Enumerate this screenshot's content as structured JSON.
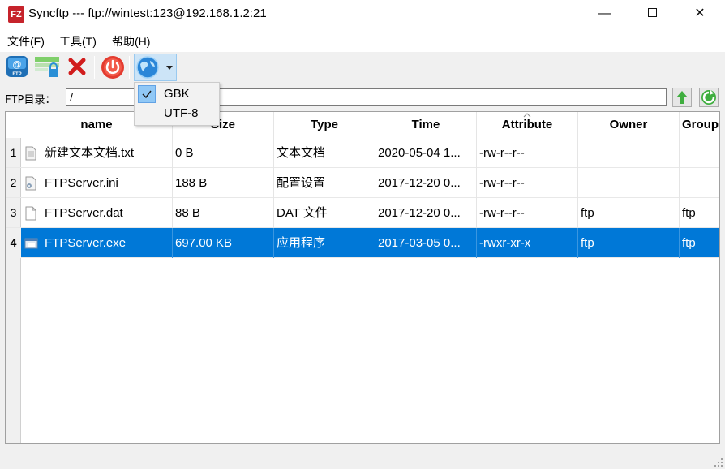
{
  "window": {
    "title": "Syncftp --- ftp://wintest:123@192.168.1.2:21",
    "app_icon_letters": "FZ",
    "minimize_glyph": "—",
    "close_glyph": "✕"
  },
  "menu": {
    "items": [
      {
        "label": "文件(F)"
      },
      {
        "label": "工具(T)"
      },
      {
        "label": "帮助(H)"
      }
    ]
  },
  "toolbar": {
    "buttons": [
      {
        "icon": "ftp-connect-icon"
      },
      {
        "icon": "lock-connection-icon"
      },
      {
        "icon": "disconnect-x-icon"
      },
      {
        "icon": "power-icon"
      },
      {
        "icon": "globe-encoding-icon"
      }
    ]
  },
  "encoding_menu": {
    "items": [
      {
        "label": "GBK",
        "checked": true
      },
      {
        "label": "UTF-8",
        "checked": false
      }
    ]
  },
  "path": {
    "label": "FTP目录：",
    "value": "/"
  },
  "table": {
    "columns": [
      "name",
      "Size",
      "Type",
      "Time",
      "Attribute",
      "Owner",
      "Group"
    ],
    "rows": [
      {
        "num": "1",
        "name": "新建文本文档.txt",
        "size": "0 B",
        "type": "文本文档",
        "time": "2020-05-04 1...",
        "attribute": "-rw-r--r--",
        "owner": "",
        "group": ""
      },
      {
        "num": "2",
        "name": "FTPServer.ini",
        "size": "188 B",
        "type": "配置设置",
        "time": "2017-12-20 0...",
        "attribute": "-rw-r--r--",
        "owner": "",
        "group": ""
      },
      {
        "num": "3",
        "name": "FTPServer.dat",
        "size": "88 B",
        "type": "DAT 文件",
        "time": "2017-12-20 0...",
        "attribute": "-rw-r--r--",
        "owner": "ftp",
        "group": "ftp"
      },
      {
        "num": "4",
        "name": "FTPServer.exe",
        "size": "697.00 KB",
        "type": "应用程序",
        "time": "2017-03-05 0...",
        "attribute": "-rwxr-xr-x",
        "owner": "ftp",
        "group": "ftp",
        "selected": true
      }
    ]
  },
  "colors": {
    "selection": "#0078d7",
    "app_icon": "#c6232b"
  }
}
